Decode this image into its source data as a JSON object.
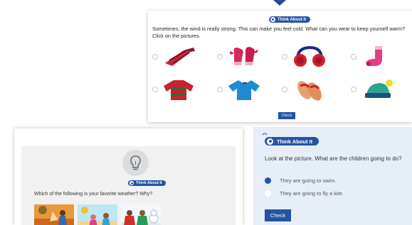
{
  "colors": {
    "accent": "#2455a4",
    "panel_blue": "#e6eff8",
    "panel_grey": "#f1f1f1"
  },
  "top_card": {
    "badge": "Think About It",
    "question": "Sometimes, the wind is really strong. This can make you feel cold. What can you wear to keep yourself warm? Click on the pictures.",
    "options": [
      {
        "icon": "scarf-icon",
        "selected": false
      },
      {
        "icon": "mittens-icon",
        "selected": false
      },
      {
        "icon": "earmuffs-icon",
        "selected": false
      },
      {
        "icon": "sock-icon",
        "selected": false
      },
      {
        "icon": "sweater-icon",
        "selected": false
      },
      {
        "icon": "tshirt-icon",
        "selected": false
      },
      {
        "icon": "sandals-icon",
        "selected": false
      },
      {
        "icon": "winter-hat-icon",
        "selected": false
      }
    ],
    "check_label": "Check"
  },
  "left_card": {
    "badge": "Think About It",
    "question": "Which of the following is your favorite weather? Why?",
    "images": [
      "autumn-weather-image",
      "summer-weather-image",
      "winter-weather-image"
    ]
  },
  "right_card": {
    "badge": "Think About It",
    "question": "Look at the picture. What are the children going to do?",
    "answers": [
      {
        "label": "They are going to swim.",
        "selected": true
      },
      {
        "label": "They are going to fly a kite.",
        "selected": false
      }
    ],
    "check_label": "Check"
  }
}
